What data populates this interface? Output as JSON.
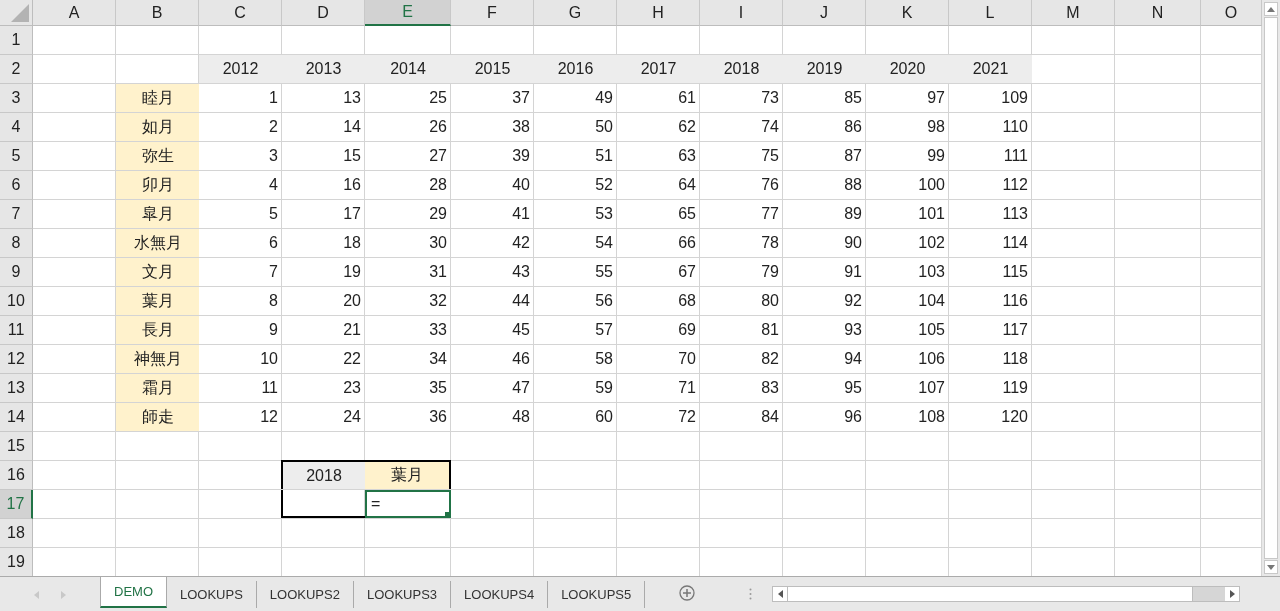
{
  "sheet": {
    "columns": [
      {
        "label": "A",
        "selected": false
      },
      {
        "label": "B",
        "selected": false
      },
      {
        "label": "C",
        "selected": false
      },
      {
        "label": "D",
        "selected": false
      },
      {
        "label": "E",
        "selected": true
      },
      {
        "label": "F",
        "selected": false
      },
      {
        "label": "G",
        "selected": false
      },
      {
        "label": "H",
        "selected": false
      },
      {
        "label": "I",
        "selected": false
      },
      {
        "label": "J",
        "selected": false
      },
      {
        "label": "K",
        "selected": false
      },
      {
        "label": "L",
        "selected": false
      },
      {
        "label": "M",
        "selected": false
      },
      {
        "label": "N",
        "selected": false
      },
      {
        "label": "O",
        "selected": false
      }
    ],
    "rows": [
      {
        "label": "1",
        "selected": false
      },
      {
        "label": "2",
        "selected": false,
        "cells": [
          null,
          null,
          {
            "kind": "year-header",
            "text": "2012",
            "selected": false
          },
          {
            "kind": "year-header",
            "text": "2013",
            "selected": false
          },
          {
            "kind": "year-header",
            "text": "2014",
            "selected": false
          },
          {
            "kind": "year-header",
            "text": "2015",
            "selected": false
          },
          {
            "kind": "year-header",
            "text": "2016",
            "selected": false
          },
          {
            "kind": "year-header",
            "text": "2017",
            "selected": false
          },
          {
            "kind": "year-header",
            "text": "2018",
            "selected": false
          },
          {
            "kind": "year-header",
            "text": "2019",
            "selected": false
          },
          {
            "kind": "year-header",
            "text": "2020",
            "selected": false
          },
          {
            "kind": "year-header",
            "text": "2021",
            "selected": false
          }
        ]
      },
      {
        "label": "3",
        "selected": false,
        "cells": [
          null,
          {
            "kind": "month",
            "text": "睦月",
            "selected": false
          },
          {
            "kind": "number",
            "text": "1",
            "selected": false
          },
          {
            "kind": "number",
            "text": "13",
            "selected": false
          },
          {
            "kind": "number",
            "text": "25",
            "selected": false
          },
          {
            "kind": "number",
            "text": "37",
            "selected": false
          },
          {
            "kind": "number",
            "text": "49",
            "selected": false
          },
          {
            "kind": "number",
            "text": "61",
            "selected": false
          },
          {
            "kind": "number",
            "text": "73",
            "selected": false
          },
          {
            "kind": "number",
            "text": "85",
            "selected": false
          },
          {
            "kind": "number",
            "text": "97",
            "selected": false
          },
          {
            "kind": "number",
            "text": "109",
            "selected": false
          }
        ]
      },
      {
        "label": "4",
        "selected": false,
        "cells": [
          null,
          {
            "kind": "month",
            "text": "如月",
            "selected": false
          },
          {
            "kind": "number",
            "text": "2",
            "selected": false
          },
          {
            "kind": "number",
            "text": "14",
            "selected": false
          },
          {
            "kind": "number",
            "text": "26",
            "selected": false
          },
          {
            "kind": "number",
            "text": "38",
            "selected": false
          },
          {
            "kind": "number",
            "text": "50",
            "selected": false
          },
          {
            "kind": "number",
            "text": "62",
            "selected": false
          },
          {
            "kind": "number",
            "text": "74",
            "selected": false
          },
          {
            "kind": "number",
            "text": "86",
            "selected": false
          },
          {
            "kind": "number",
            "text": "98",
            "selected": false
          },
          {
            "kind": "number",
            "text": "110",
            "selected": false
          }
        ]
      },
      {
        "label": "5",
        "selected": false,
        "cells": [
          null,
          {
            "kind": "month",
            "text": "弥生",
            "selected": false
          },
          {
            "kind": "number",
            "text": "3",
            "selected": false
          },
          {
            "kind": "number",
            "text": "15",
            "selected": false
          },
          {
            "kind": "number",
            "text": "27",
            "selected": false
          },
          {
            "kind": "number",
            "text": "39",
            "selected": false
          },
          {
            "kind": "number",
            "text": "51",
            "selected": false
          },
          {
            "kind": "number",
            "text": "63",
            "selected": false
          },
          {
            "kind": "number",
            "text": "75",
            "selected": false
          },
          {
            "kind": "number",
            "text": "87",
            "selected": false
          },
          {
            "kind": "number",
            "text": "99",
            "selected": false
          },
          {
            "kind": "number",
            "text": "111",
            "selected": false
          }
        ]
      },
      {
        "label": "6",
        "selected": false,
        "cells": [
          null,
          {
            "kind": "month",
            "text": "卯月",
            "selected": false
          },
          {
            "kind": "number",
            "text": "4",
            "selected": false
          },
          {
            "kind": "number",
            "text": "16",
            "selected": false
          },
          {
            "kind": "number",
            "text": "28",
            "selected": false
          },
          {
            "kind": "number",
            "text": "40",
            "selected": false
          },
          {
            "kind": "number",
            "text": "52",
            "selected": false
          },
          {
            "kind": "number",
            "text": "64",
            "selected": false
          },
          {
            "kind": "number",
            "text": "76",
            "selected": false
          },
          {
            "kind": "number",
            "text": "88",
            "selected": false
          },
          {
            "kind": "number",
            "text": "100",
            "selected": false
          },
          {
            "kind": "number",
            "text": "112",
            "selected": false
          }
        ]
      },
      {
        "label": "7",
        "selected": false,
        "cells": [
          null,
          {
            "kind": "month",
            "text": "皐月",
            "selected": false
          },
          {
            "kind": "number",
            "text": "5",
            "selected": false
          },
          {
            "kind": "number",
            "text": "17",
            "selected": false
          },
          {
            "kind": "number",
            "text": "29",
            "selected": false
          },
          {
            "kind": "number",
            "text": "41",
            "selected": false
          },
          {
            "kind": "number",
            "text": "53",
            "selected": false
          },
          {
            "kind": "number",
            "text": "65",
            "selected": false
          },
          {
            "kind": "number",
            "text": "77",
            "selected": false
          },
          {
            "kind": "number",
            "text": "89",
            "selected": false
          },
          {
            "kind": "number",
            "text": "101",
            "selected": false
          },
          {
            "kind": "number",
            "text": "113",
            "selected": false
          }
        ]
      },
      {
        "label": "8",
        "selected": false,
        "cells": [
          null,
          {
            "kind": "month",
            "text": "水無月",
            "selected": false
          },
          {
            "kind": "number",
            "text": "6",
            "selected": false
          },
          {
            "kind": "number",
            "text": "18",
            "selected": false
          },
          {
            "kind": "number",
            "text": "30",
            "selected": false
          },
          {
            "kind": "number",
            "text": "42",
            "selected": false
          },
          {
            "kind": "number",
            "text": "54",
            "selected": false
          },
          {
            "kind": "number",
            "text": "66",
            "selected": false
          },
          {
            "kind": "number",
            "text": "78",
            "selected": false
          },
          {
            "kind": "number",
            "text": "90",
            "selected": false
          },
          {
            "kind": "number",
            "text": "102",
            "selected": false
          },
          {
            "kind": "number",
            "text": "114",
            "selected": false
          }
        ]
      },
      {
        "label": "9",
        "selected": false,
        "cells": [
          null,
          {
            "kind": "month",
            "text": "文月",
            "selected": false
          },
          {
            "kind": "number",
            "text": "7",
            "selected": false
          },
          {
            "kind": "number",
            "text": "19",
            "selected": false
          },
          {
            "kind": "number",
            "text": "31",
            "selected": false
          },
          {
            "kind": "number",
            "text": "43",
            "selected": false
          },
          {
            "kind": "number",
            "text": "55",
            "selected": false
          },
          {
            "kind": "number",
            "text": "67",
            "selected": false
          },
          {
            "kind": "number",
            "text": "79",
            "selected": false
          },
          {
            "kind": "number",
            "text": "91",
            "selected": false
          },
          {
            "kind": "number",
            "text": "103",
            "selected": false
          },
          {
            "kind": "number",
            "text": "115",
            "selected": false
          }
        ]
      },
      {
        "label": "10",
        "selected": false,
        "cells": [
          null,
          {
            "kind": "month",
            "text": "葉月",
            "selected": false
          },
          {
            "kind": "number",
            "text": "8",
            "selected": false
          },
          {
            "kind": "number",
            "text": "20",
            "selected": false
          },
          {
            "kind": "number",
            "text": "32",
            "selected": false
          },
          {
            "kind": "number",
            "text": "44",
            "selected": false
          },
          {
            "kind": "number",
            "text": "56",
            "selected": false
          },
          {
            "kind": "number",
            "text": "68",
            "selected": false
          },
          {
            "kind": "number",
            "text": "80",
            "selected": false
          },
          {
            "kind": "number",
            "text": "92",
            "selected": false
          },
          {
            "kind": "number",
            "text": "104",
            "selected": false
          },
          {
            "kind": "number",
            "text": "116",
            "selected": false
          }
        ]
      },
      {
        "label": "11",
        "selected": false,
        "cells": [
          null,
          {
            "kind": "month",
            "text": "長月",
            "selected": false
          },
          {
            "kind": "number",
            "text": "9",
            "selected": false
          },
          {
            "kind": "number",
            "text": "21",
            "selected": false
          },
          {
            "kind": "number",
            "text": "33",
            "selected": false
          },
          {
            "kind": "number",
            "text": "45",
            "selected": false
          },
          {
            "kind": "number",
            "text": "57",
            "selected": false
          },
          {
            "kind": "number",
            "text": "69",
            "selected": false
          },
          {
            "kind": "number",
            "text": "81",
            "selected": false
          },
          {
            "kind": "number",
            "text": "93",
            "selected": false
          },
          {
            "kind": "number",
            "text": "105",
            "selected": false
          },
          {
            "kind": "number",
            "text": "117",
            "selected": false
          }
        ]
      },
      {
        "label": "12",
        "selected": false,
        "cells": [
          null,
          {
            "kind": "month",
            "text": "神無月",
            "selected": false
          },
          {
            "kind": "number",
            "text": "10",
            "selected": false
          },
          {
            "kind": "number",
            "text": "22",
            "selected": false
          },
          {
            "kind": "number",
            "text": "34",
            "selected": false
          },
          {
            "kind": "number",
            "text": "46",
            "selected": false
          },
          {
            "kind": "number",
            "text": "58",
            "selected": false
          },
          {
            "kind": "number",
            "text": "70",
            "selected": false
          },
          {
            "kind": "number",
            "text": "82",
            "selected": false
          },
          {
            "kind": "number",
            "text": "94",
            "selected": false
          },
          {
            "kind": "number",
            "text": "106",
            "selected": false
          },
          {
            "kind": "number",
            "text": "118",
            "selected": false
          }
        ]
      },
      {
        "label": "13",
        "selected": false,
        "cells": [
          null,
          {
            "kind": "month",
            "text": "霜月",
            "selected": false
          },
          {
            "kind": "number",
            "text": "11",
            "selected": false
          },
          {
            "kind": "number",
            "text": "23",
            "selected": false
          },
          {
            "kind": "number",
            "text": "35",
            "selected": false
          },
          {
            "kind": "number",
            "text": "47",
            "selected": false
          },
          {
            "kind": "number",
            "text": "59",
            "selected": false
          },
          {
            "kind": "number",
            "text": "71",
            "selected": false
          },
          {
            "kind": "number",
            "text": "83",
            "selected": false
          },
          {
            "kind": "number",
            "text": "95",
            "selected": false
          },
          {
            "kind": "number",
            "text": "107",
            "selected": false
          },
          {
            "kind": "number",
            "text": "119",
            "selected": false
          }
        ]
      },
      {
        "label": "14",
        "selected": false,
        "cells": [
          null,
          {
            "kind": "month",
            "text": "師走",
            "selected": false
          },
          {
            "kind": "number",
            "text": "12",
            "selected": false
          },
          {
            "kind": "number",
            "text": "24",
            "selected": false
          },
          {
            "kind": "number",
            "text": "36",
            "selected": false
          },
          {
            "kind": "number",
            "text": "48",
            "selected": false
          },
          {
            "kind": "number",
            "text": "60",
            "selected": false
          },
          {
            "kind": "number",
            "text": "72",
            "selected": false
          },
          {
            "kind": "number",
            "text": "84",
            "selected": false
          },
          {
            "kind": "number",
            "text": "96",
            "selected": false
          },
          {
            "kind": "number",
            "text": "108",
            "selected": false
          },
          {
            "kind": "number",
            "text": "120",
            "selected": false
          }
        ]
      },
      {
        "label": "15",
        "selected": false
      },
      {
        "label": "16",
        "selected": false,
        "cells": [
          null,
          null,
          null,
          {
            "kind": "lookup-year",
            "text": "2018",
            "selected": false
          },
          {
            "kind": "lookup-month",
            "text": "葉月",
            "selected": false
          }
        ]
      },
      {
        "label": "17",
        "selected": true,
        "cells": [
          null,
          null,
          null,
          {
            "kind": "lookup-blank",
            "selected": false
          },
          {
            "kind": "lookup-input",
            "text": "=",
            "selected": true
          }
        ]
      },
      {
        "label": "18",
        "selected": false
      },
      {
        "label": "19",
        "selected": false
      }
    ]
  },
  "sheet_tabs": [
    {
      "label": "DEMO",
      "selected": true
    },
    {
      "label": "LOOKUPS",
      "selected": false
    },
    {
      "label": "LOOKUPS2",
      "selected": false
    },
    {
      "label": "LOOKUPS3",
      "selected": false
    },
    {
      "label": "LOOKUPS4",
      "selected": false
    },
    {
      "label": "LOOKUPS5",
      "selected": false
    }
  ]
}
